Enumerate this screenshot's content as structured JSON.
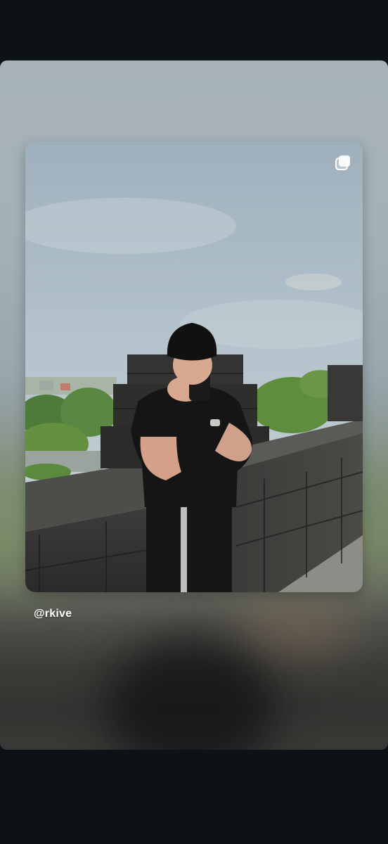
{
  "story": {
    "username": "@rkive"
  },
  "icons": {
    "multi_post": "multiple-posts-icon"
  },
  "colors": {
    "background": "#0d1216",
    "username_text": "#ffffff"
  }
}
